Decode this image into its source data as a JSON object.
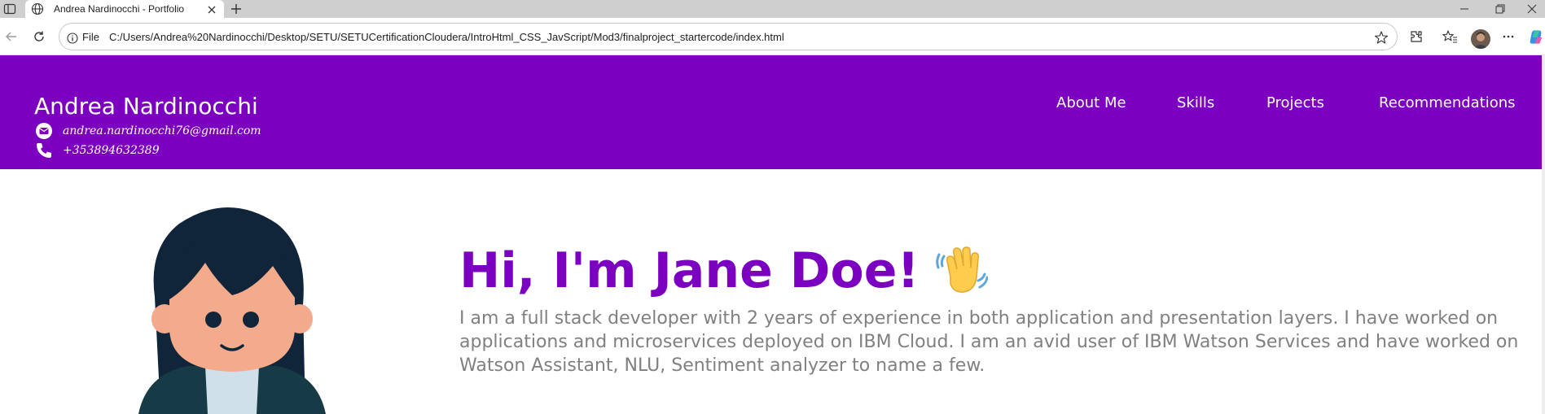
{
  "browser": {
    "tab_title": "Andrea Nardinocchi - Portfolio",
    "url_scheme": "File",
    "url": "C:/Users/Andrea%20Nardinocchi/Desktop/SETU/SETUCertificationCloudera/IntroHtml_CSS_JavScript/Mod3/finalproject_startercode/index.html"
  },
  "header": {
    "name": "Andrea Nardinocchi",
    "email": "andrea.nardinocchi76@gmail.com",
    "phone": "+353894632389",
    "nav": [
      "About Me",
      "Skills",
      "Projects",
      "Recommendations"
    ]
  },
  "hero": {
    "title": "Hi, I'm Jane Doe!",
    "bio": "I am a full stack developer with 2 years of experience in both application and presentation layers. I have worked on applications and microservices deployed on IBM Cloud. I am an avid user of IBM Watson Services and have worked on Watson Assistant, NLU, Sentiment analyzer to name a few."
  },
  "colors": {
    "brand": "#7b00bf",
    "bio_text": "#808080"
  },
  "icons": [
    "sidebar-toggle-icon",
    "globe-icon",
    "close-icon",
    "plus-icon",
    "minimize-icon",
    "restore-icon",
    "back-icon",
    "reload-icon",
    "info-icon",
    "star-icon",
    "extensions-icon",
    "favorites-icon",
    "more-icon",
    "copilot-icon",
    "email-icon",
    "phone-icon",
    "waving-hand-icon"
  ]
}
